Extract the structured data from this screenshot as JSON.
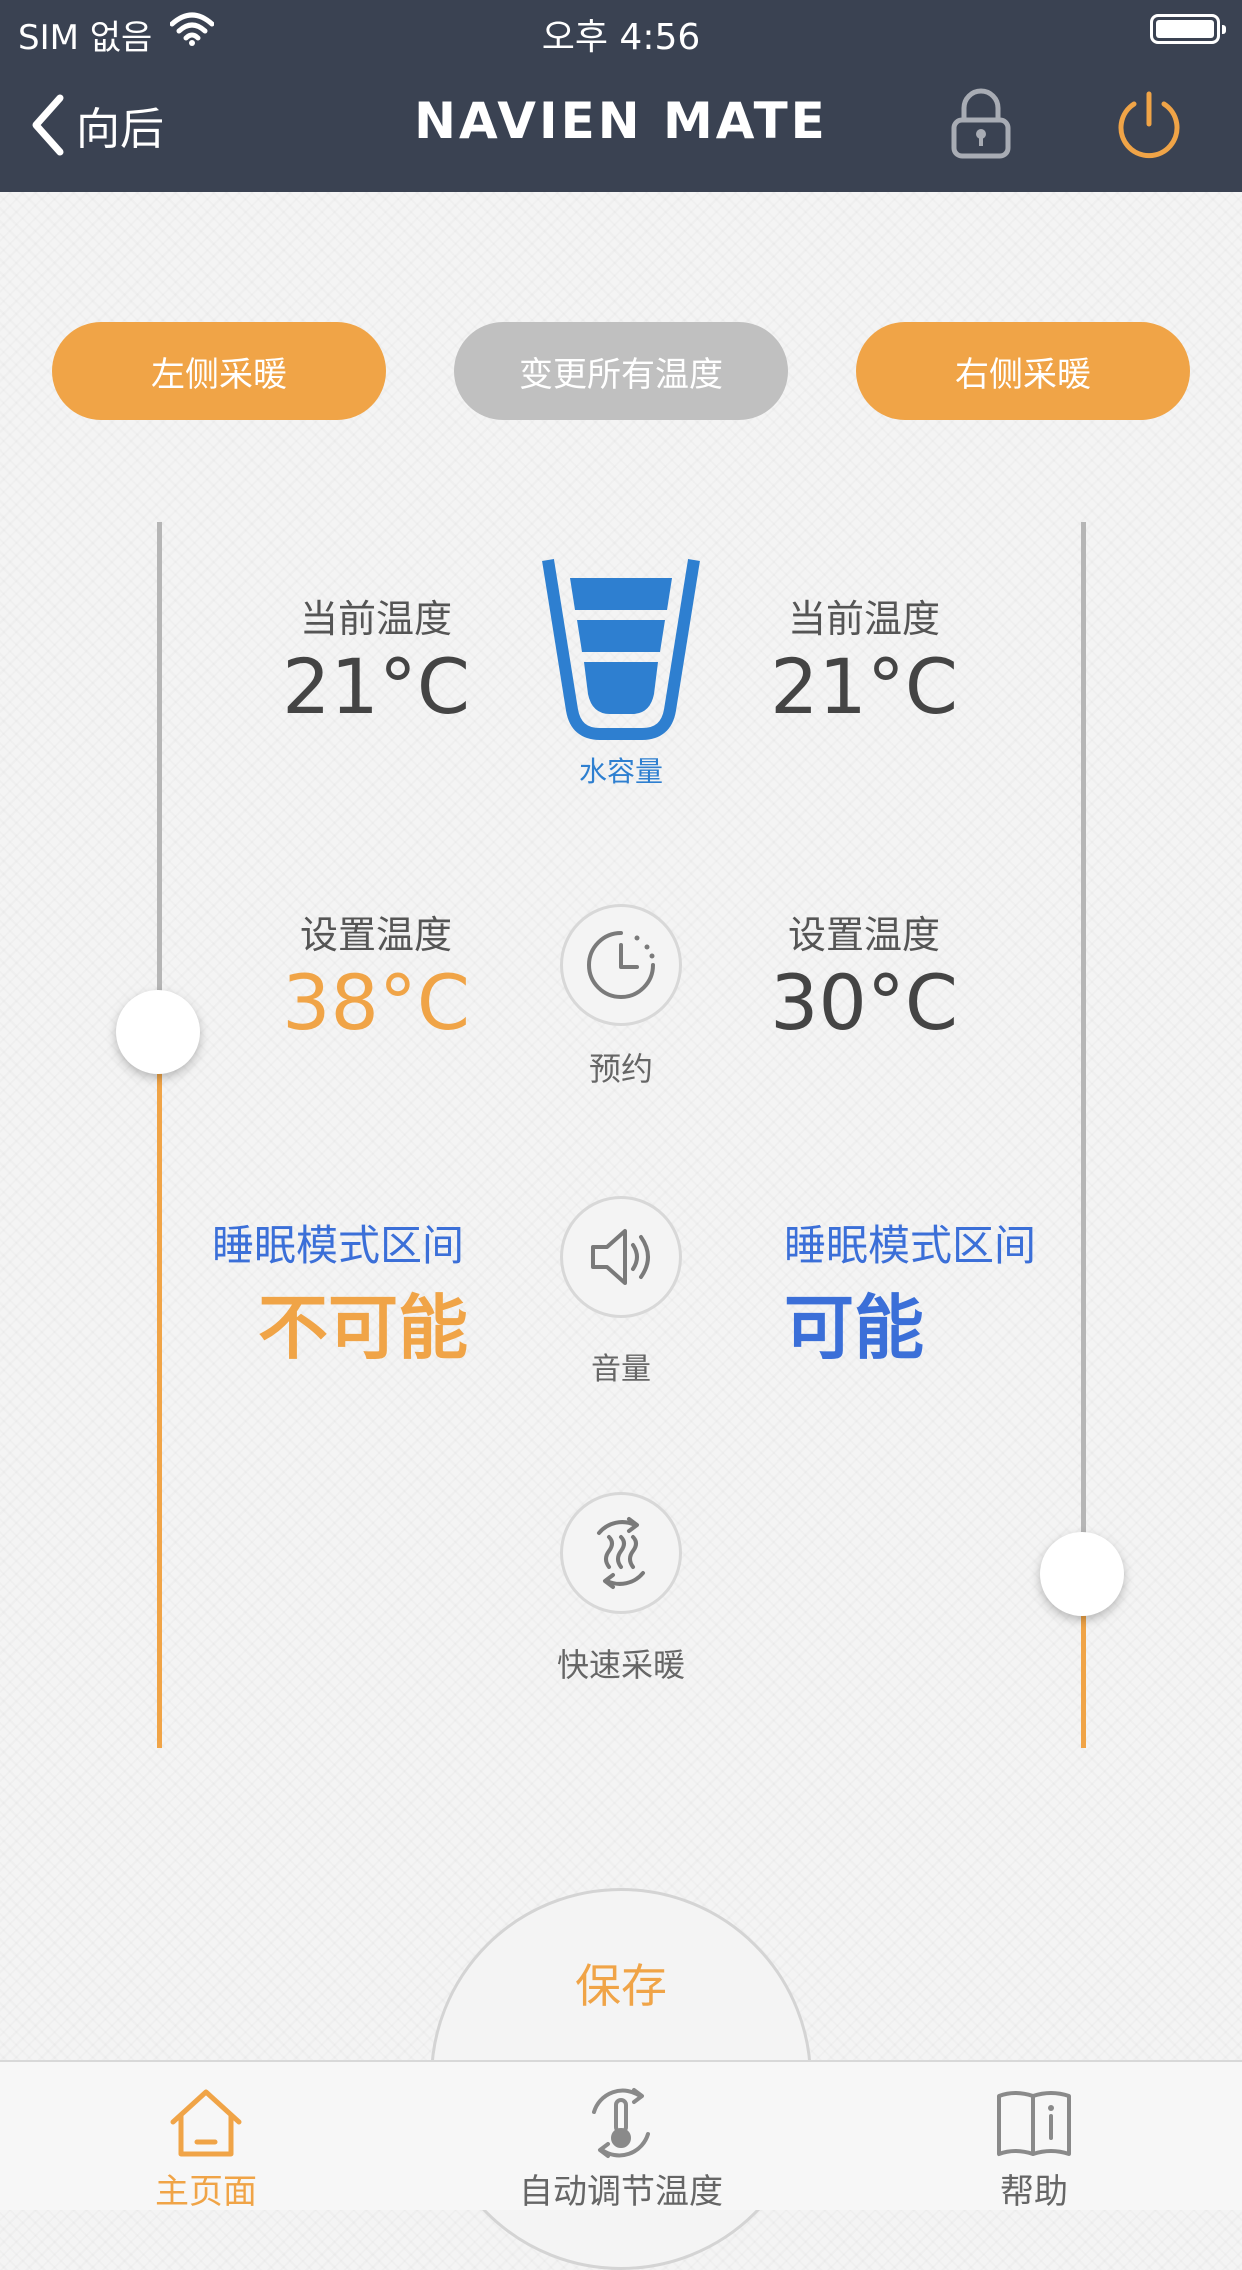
{
  "status_bar": {
    "carrier": "SIM 없음",
    "time": "오후 4:56"
  },
  "header": {
    "back_label": "向后",
    "logo": "NAVIEN MATE"
  },
  "modes": {
    "left": "左侧采暖",
    "all": "变更所有温度",
    "right": "右侧采暖"
  },
  "left_side": {
    "current_label": "当前温度",
    "current_temp": "21°C",
    "set_label": "设置温度",
    "set_temp": "38°C",
    "sleep_label": "睡眠模式区间",
    "sleep_value": "不可能"
  },
  "right_side": {
    "current_label": "当前温度",
    "current_temp": "21°C",
    "set_label": "设置温度",
    "set_temp": "30°C",
    "sleep_label": "睡眠模式区间",
    "sleep_value": "可能"
  },
  "center": {
    "water_label": "水容量",
    "schedule_label": "预约",
    "volume_label": "音量",
    "quick_heat_label": "快速采暖"
  },
  "save_label": "保存",
  "tabs": [
    {
      "label": "主页面",
      "active": true
    },
    {
      "label": "自动调节温度",
      "active": false
    },
    {
      "label": "帮助",
      "active": false
    }
  ],
  "colors": {
    "accent": "#f0a447",
    "header_bg": "#3a4252",
    "blue": "#3b6fd8",
    "water_blue": "#2e7fd0"
  }
}
